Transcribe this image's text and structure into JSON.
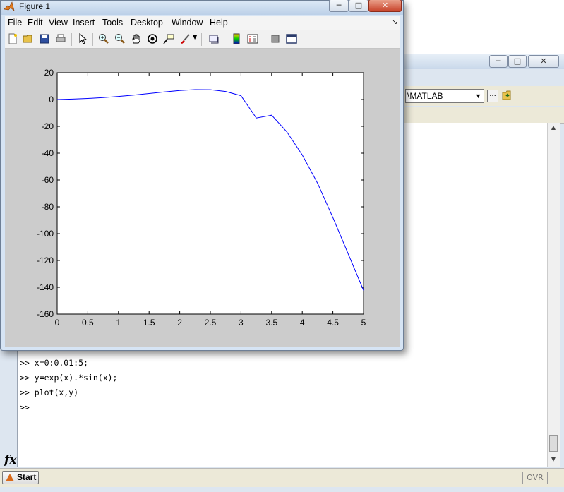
{
  "figure": {
    "title": "Figure 1",
    "menu": [
      "File",
      "Edit",
      "View",
      "Insert",
      "Tools",
      "Desktop",
      "Window",
      "Help"
    ],
    "toolbar_icons": [
      "new-figure-icon",
      "open-file-icon",
      "save-figure-icon",
      "print-figure-icon",
      "edit-plot-arrow-icon",
      "zoom-in-icon",
      "zoom-out-icon",
      "pan-hand-icon",
      "rotate-3d-icon",
      "data-cursor-icon",
      "brush-icon",
      "link-plot-icon",
      "insert-colorbar-icon",
      "insert-legend-icon",
      "hide-plot-tools-icon",
      "show-plot-tools-icon"
    ],
    "window_buttons": [
      "minimize",
      "maximize",
      "close"
    ]
  },
  "chart_data": {
    "type": "line",
    "x": [
      0,
      0.25,
      0.5,
      0.75,
      1,
      1.25,
      1.5,
      1.75,
      2,
      2.25,
      2.5,
      2.75,
      3,
      3.25,
      3.5,
      3.75,
      4,
      4.25,
      4.5,
      4.75,
      5
    ],
    "y": [
      0,
      0.32,
      0.79,
      1.44,
      2.29,
      3.32,
      4.47,
      5.63,
      6.72,
      7.38,
      7.32,
      5.99,
      2.83,
      -13.8,
      -11.67,
      -24.2,
      -41.34,
      -62.4,
      -88.0,
      -115.1,
      -142.32
    ],
    "xticks": [
      "0",
      "0.5",
      "1",
      "1.5",
      "2",
      "2.5",
      "3",
      "3.5",
      "4",
      "4.5",
      "5"
    ],
    "yticks": [
      "20",
      "0",
      "-20",
      "-40",
      "-60",
      "-80",
      "-100",
      "-120",
      "-140",
      "-160"
    ],
    "xlim": [
      0,
      5
    ],
    "ylim": [
      -160,
      20
    ],
    "line_color": "#0000ff",
    "grid": false
  },
  "matlab": {
    "window_buttons": [
      "minimize",
      "maximize",
      "close"
    ],
    "current_folder": "\\MATLAB",
    "browse_label": "...",
    "command_lines": [
      ">> x=0:0.01:5;",
      ">> y=exp(x).*sin(x);",
      ">> plot(x,y)",
      ">>"
    ],
    "fx_label": "fx",
    "start_label": "Start",
    "status_ovr": "OVR"
  }
}
